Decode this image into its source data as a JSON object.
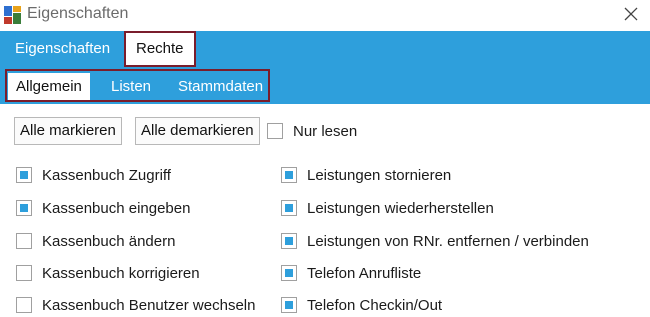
{
  "window": {
    "title": "Eigenschaften",
    "accent_color": "#2e9fdc",
    "highlight_color": "#7a1d2c"
  },
  "tabs": [
    {
      "label": "Eigenschaften",
      "active": false
    },
    {
      "label": "Rechte",
      "active": true
    }
  ],
  "subtabs": [
    {
      "label": "Allgemein",
      "active": true
    },
    {
      "label": "Listen",
      "active": false
    },
    {
      "label": "Stammdaten",
      "active": false
    }
  ],
  "toolbar": {
    "select_all_label": "Alle markieren",
    "deselect_all_label": "Alle demarkieren",
    "readonly_label": "Nur lesen",
    "readonly_checked": false
  },
  "left_permissions": [
    {
      "label": "Kassenbuch Zugriff",
      "checked": true
    },
    {
      "label": "Kassenbuch eingeben",
      "checked": true
    },
    {
      "label": "Kassenbuch ändern",
      "checked": false
    },
    {
      "label": "Kassenbuch korrigieren",
      "checked": false
    },
    {
      "label": "Kassenbuch Benutzer wechseln",
      "checked": false
    }
  ],
  "right_permissions": [
    {
      "label": "Leistungen stornieren",
      "checked": true
    },
    {
      "label": "Leistungen wiederherstellen",
      "checked": true
    },
    {
      "label": "Leistungen von RNr. entfernen / verbinden",
      "checked": true
    },
    {
      "label": "Telefon Anrufliste",
      "checked": true
    },
    {
      "label": "Telefon Checkin/Out",
      "checked": true
    }
  ]
}
